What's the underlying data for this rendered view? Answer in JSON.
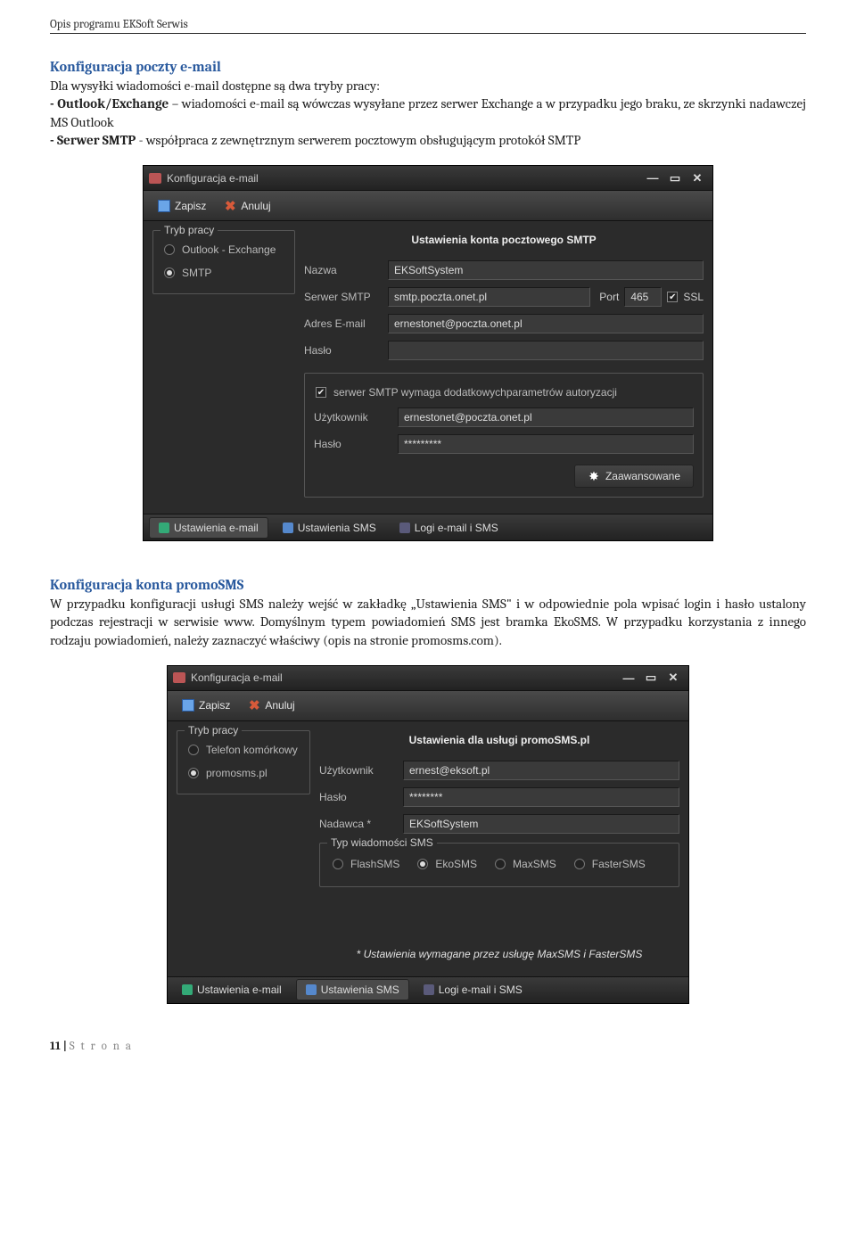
{
  "doc": {
    "header": "Opis programu EKSoft Serwis",
    "footer_num": "11 | ",
    "footer_word": "S t r o n a"
  },
  "section1": {
    "title": "Konfiguracja poczty e-mail",
    "p1a": "Dla wysyłki wiadomości e-mail dostępne są dwa tryby pracy:",
    "b1": "- Outlook/Exchange",
    "p1b": " – wiadomości e-mail są wówczas wysyłane przez serwer Exchange a w przypadku jego braku, ze skrzynki nadawczej MS Outlook",
    "b2": "- Serwer SMTP",
    "p1c": " - współpraca z zewnętrznym serwerem pocztowym obsługującym protokół SMTP"
  },
  "window1": {
    "title": "Konfiguracja e-mail",
    "save": "Zapisz",
    "cancel": "Anuluj",
    "mode_title": "Tryb pracy",
    "mode_opt1": "Outlook - Exchange",
    "mode_opt2": "SMTP",
    "settings_title": "Ustawienia konta pocztowego SMTP",
    "name_label": "Nazwa",
    "name_value": "EKSoftSystem",
    "server_label": "Serwer SMTP",
    "server_value": "smtp.poczta.onet.pl",
    "port_label": "Port",
    "port_value": "465",
    "ssl_label": "SSL",
    "email_label": "Adres E-mail",
    "email_value": "ernestonet@poczta.onet.pl",
    "pass_label": "Hasło",
    "auth_check": "serwer SMTP wymaga dodatkowychparametrów autoryzacji",
    "user_label": "Użytkownik",
    "user_value": "ernestonet@poczta.onet.pl",
    "pass2_label": "Hasło",
    "pass2_value": "*********",
    "advanced": "Zaawansowane",
    "tab1": "Ustawienia e-mail",
    "tab2": "Ustawienia SMS",
    "tab3": "Logi e-mail i SMS"
  },
  "section2": {
    "title": "Konfiguracja konta promoSMS",
    "p": "W przypadku konfiguracji usługi SMS należy wejść w zakładkę „Ustawienia SMS\" i w odpowiednie pola wpisać login i hasło ustalony podczas rejestracji w serwisie www. Domyślnym typem powiadomień SMS jest bramka EkoSMS. W przypadku korzystania z innego rodzaju powiadomień, należy zaznaczyć właściwy (opis na stronie promosms.com)."
  },
  "window2": {
    "title": "Konfiguracja e-mail",
    "save": "Zapisz",
    "cancel": "Anuluj",
    "mode_title": "Tryb pracy",
    "mode_opt1": "Telefon komórkowy",
    "mode_opt2": "promosms.pl",
    "settings_title": "Ustawienia dla usługi promoSMS.pl",
    "user_label": "Użytkownik",
    "user_value": "ernest@eksoft.pl",
    "pass_label": "Hasło",
    "pass_value": "********",
    "sender_label": "Nadawca *",
    "sender_value": "EKSoftSystem",
    "smstype_title": "Typ wiadomości SMS",
    "sms_opt1": "FlashSMS",
    "sms_opt2": "EkoSMS",
    "sms_opt3": "MaxSMS",
    "sms_opt4": "FasterSMS",
    "note": "* Ustawienia wymagane przez usługę MaxSMS i FasterSMS",
    "tab1": "Ustawienia e-mail",
    "tab2": "Ustawienia SMS",
    "tab3": "Logi e-mail i SMS"
  }
}
